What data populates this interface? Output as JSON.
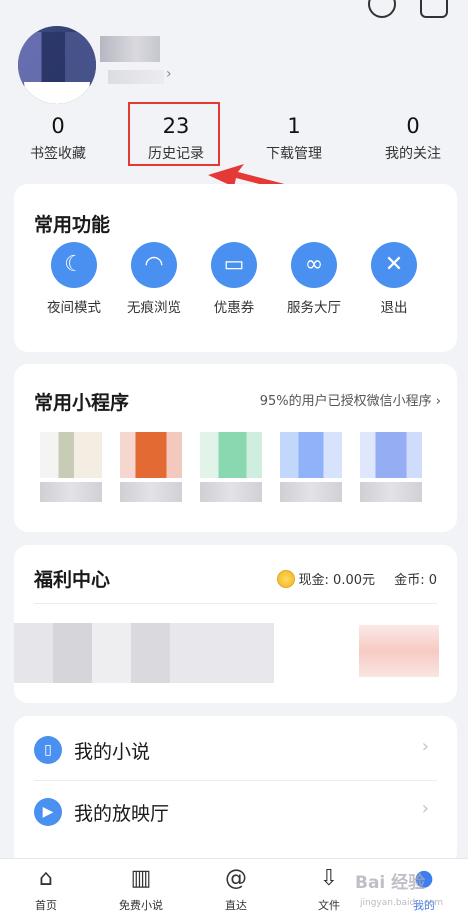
{
  "header": {
    "name_blurred": true,
    "stats": [
      {
        "count": "0",
        "label": "书签收藏"
      },
      {
        "count": "23",
        "label": "历史记录"
      },
      {
        "count": "1",
        "label": "下载管理"
      },
      {
        "count": "0",
        "label": "我的关注"
      }
    ]
  },
  "common_functions": {
    "title": "常用功能",
    "items": [
      {
        "label": "夜间模式",
        "icon": "night-mode-icon"
      },
      {
        "label": "无痕浏览",
        "icon": "ghost-icon"
      },
      {
        "label": "优惠券",
        "icon": "coupon-icon"
      },
      {
        "label": "服务大厅",
        "icon": "link-icon"
      },
      {
        "label": "退出",
        "icon": "close-icon"
      }
    ]
  },
  "mini_programs": {
    "title": "常用小程序",
    "link_text": "95%的用户已授权微信小程序",
    "link_chevron": "›"
  },
  "welfare": {
    "title": "福利中心",
    "cash_label": "现金: 0.00元",
    "gold_label": "金币: 0"
  },
  "list": [
    {
      "label": "我的小说",
      "icon": "book-icon"
    },
    {
      "label": "我的放映厅",
      "icon": "play-icon"
    }
  ],
  "bottom_nav": [
    {
      "label": "首页",
      "icon": "home-icon"
    },
    {
      "label": "免费小说",
      "icon": "open-book-icon"
    },
    {
      "label": "直达",
      "icon": "at-icon"
    },
    {
      "label": "文件",
      "icon": "download-folder-icon"
    },
    {
      "label": "我的",
      "icon": "user-icon",
      "active": true
    }
  ],
  "watermark": {
    "text": "Bai 经验",
    "sub": "jingyan.baidu.com"
  },
  "colors": {
    "accent": "#4a90f0",
    "annotation_red": "#e53935",
    "nav_active": "#3d7df0"
  }
}
